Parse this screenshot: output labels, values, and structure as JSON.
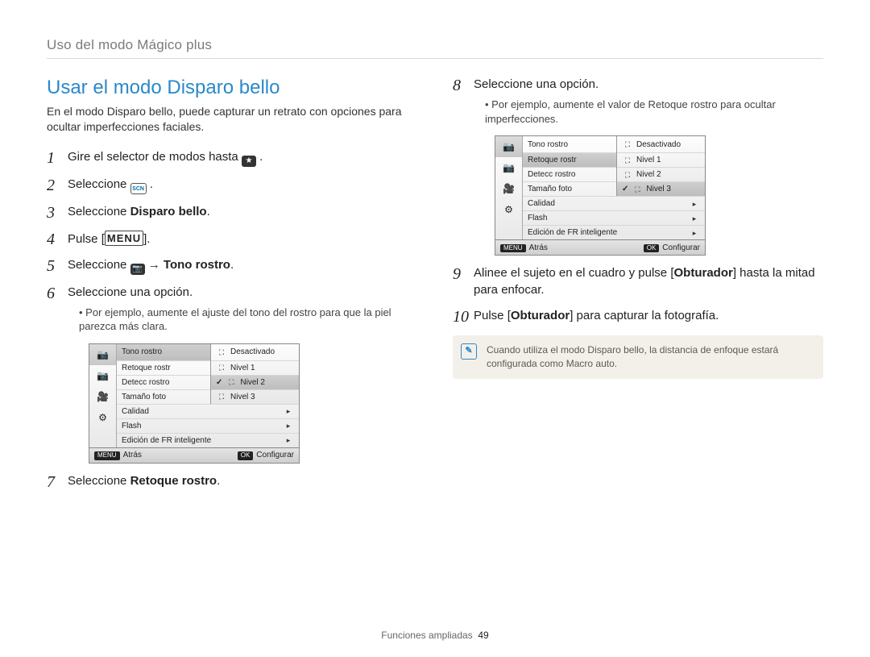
{
  "breadcrumb": "Uso del modo Mágico plus",
  "title": "Usar el modo Disparo bello",
  "intro": "En el modo Disparo bello, puede capturar un retrato con opciones para ocultar imperfecciones faciales.",
  "left_steps": {
    "s1_a": "Gire el selector de modos hasta ",
    "s1_b": ".",
    "s2_a": "Seleccione ",
    "s2_b": ".",
    "scn_label": "SCN",
    "s3_a": "Seleccione ",
    "s3_b": "Disparo bello",
    "s3_c": ".",
    "s4_a": "Pulse [",
    "s4_menu": "MENU",
    "s4_b": "].",
    "s5_a": "Seleccione ",
    "s5_arrow": " → ",
    "s5_b": "Tono rostro",
    "s5_c": ".",
    "s6": "Seleccione una opción.",
    "s6_sub": "Por ejemplo, aumente el ajuste del tono del rostro para que la piel parezca más clara.",
    "s7_a": "Seleccione ",
    "s7_b": "Retoque rostro",
    "s7_c": "."
  },
  "right_steps": {
    "s8": "Seleccione una opción.",
    "s8_sub": "Por ejemplo, aumente el valor de Retoque rostro para ocultar imperfecciones.",
    "s9_a": "Alinee el sujeto en el cuadro y pulse [",
    "s9_b": "Obturador",
    "s9_c": "] hasta la mitad para enfocar.",
    "s10_a": "Pulse [",
    "s10_b": "Obturador",
    "s10_c": "] para capturar la fotografía."
  },
  "screen1": {
    "left_icons": [
      "📷",
      "📷",
      "🎥",
      "⚙"
    ],
    "selected_left": 0,
    "menu": [
      "Tono rostro",
      "Retoque rostr",
      "Detecc rostro",
      "Tamaño foto",
      "Calidad",
      "Flash",
      "Edición de FR inteligente"
    ],
    "highlight_row": 0,
    "popup_title_idx": 0,
    "popup": [
      "Desactivado",
      "Nivel 1",
      "Nivel 2",
      "Nivel 3"
    ],
    "popup_selected": 2,
    "bot_left_key": "MENU",
    "bot_left": "Atrás",
    "bot_right_key": "OK",
    "bot_right": "Configurar"
  },
  "screen2": {
    "left_icons": [
      "📷",
      "📷",
      "🎥",
      "⚙"
    ],
    "selected_left": 0,
    "menu": [
      "Tono rostro",
      "Retoque rostr",
      "Detecc rostro",
      "Tamaño foto",
      "Calidad",
      "Flash",
      "Edición de FR inteligente"
    ],
    "highlight_row": 1,
    "popup": [
      "Desactivado",
      "Nivel 1",
      "Nivel 2",
      "Nivel 3"
    ],
    "popup_selected": 3,
    "bot_left_key": "MENU",
    "bot_left": "Atrás",
    "bot_right_key": "OK",
    "bot_right": "Configurar"
  },
  "note": "Cuando utiliza el modo Disparo bello, la distancia de enfoque estará configurada como Macro auto.",
  "note_badge": "✎",
  "footer_label": "Funciones ampliadas",
  "footer_page": "49"
}
